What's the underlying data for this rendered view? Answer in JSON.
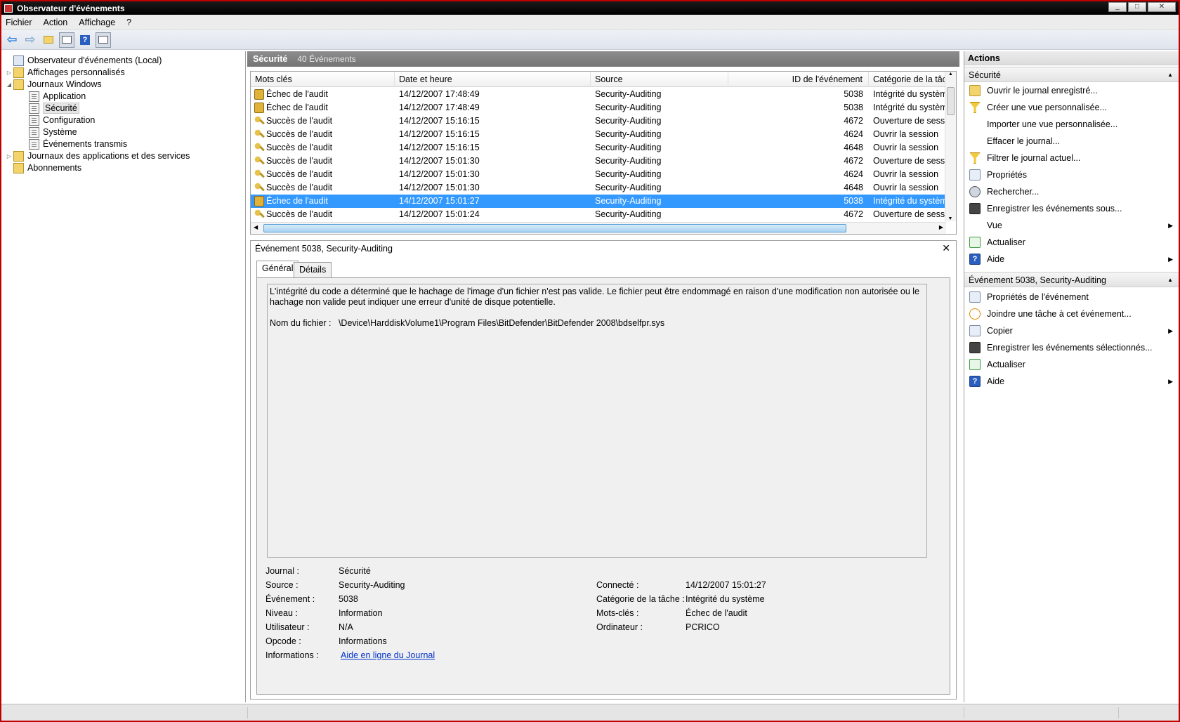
{
  "window": {
    "title": "Observateur d'événements"
  },
  "menu": [
    "Fichier",
    "Action",
    "Affichage",
    "?"
  ],
  "tree": [
    {
      "label": "Observateur d'événements (Local)",
      "icon": "event-viewer-icon"
    },
    {
      "label": "Affichages personnalisés",
      "icon": "folder-icon"
    },
    {
      "label": "Journaux Windows",
      "icon": "folder-icon"
    },
    {
      "label": "Application",
      "icon": "log-icon"
    },
    {
      "label": "Sécurité",
      "icon": "log-icon",
      "selected": true
    },
    {
      "label": "Configuration",
      "icon": "log-icon"
    },
    {
      "label": "Système",
      "icon": "log-icon"
    },
    {
      "label": "Événements transmis",
      "icon": "log-icon"
    },
    {
      "label": "Journaux des applications et des services",
      "icon": "folder-icon"
    },
    {
      "label": "Abonnements",
      "icon": "subscription-icon"
    }
  ],
  "log": {
    "name": "Sécurité",
    "count": "40 Événements"
  },
  "columns": [
    "Mots clés",
    "Date et heure",
    "Source",
    "ID de l'événement",
    "Catégorie de la tâche"
  ],
  "events": [
    {
      "kw": "Échec de l'audit",
      "date": "14/12/2007 17:48:49",
      "src": "Security-Auditing",
      "id": "5038",
      "cat": "Intégrité du système",
      "icon": "lock"
    },
    {
      "kw": "Échec de l'audit",
      "date": "14/12/2007 17:48:49",
      "src": "Security-Auditing",
      "id": "5038",
      "cat": "Intégrité du système",
      "icon": "lock"
    },
    {
      "kw": "Succès de l'audit",
      "date": "14/12/2007 15:16:15",
      "src": "Security-Auditing",
      "id": "4672",
      "cat": "Ouverture de session spéciale",
      "icon": "key"
    },
    {
      "kw": "Succès de l'audit",
      "date": "14/12/2007 15:16:15",
      "src": "Security-Auditing",
      "id": "4624",
      "cat": "Ouvrir la session",
      "icon": "key"
    },
    {
      "kw": "Succès de l'audit",
      "date": "14/12/2007 15:16:15",
      "src": "Security-Auditing",
      "id": "4648",
      "cat": "Ouvrir la session",
      "icon": "key"
    },
    {
      "kw": "Succès de l'audit",
      "date": "14/12/2007 15:01:30",
      "src": "Security-Auditing",
      "id": "4672",
      "cat": "Ouverture de session spéciale",
      "icon": "key"
    },
    {
      "kw": "Succès de l'audit",
      "date": "14/12/2007 15:01:30",
      "src": "Security-Auditing",
      "id": "4624",
      "cat": "Ouvrir la session",
      "icon": "key"
    },
    {
      "kw": "Succès de l'audit",
      "date": "14/12/2007 15:01:30",
      "src": "Security-Auditing",
      "id": "4648",
      "cat": "Ouvrir la session",
      "icon": "key"
    },
    {
      "kw": "Échec de l'audit",
      "date": "14/12/2007 15:01:27",
      "src": "Security-Auditing",
      "id": "5038",
      "cat": "Intégrité du système",
      "icon": "lock",
      "selected": true
    },
    {
      "kw": "Succès de l'audit",
      "date": "14/12/2007 15:01:24",
      "src": "Security-Auditing",
      "id": "4672",
      "cat": "Ouverture de session spéciale",
      "icon": "key"
    }
  ],
  "detail": {
    "title": "Événement 5038, Security-Auditing",
    "tabs": [
      "Général",
      "Détails"
    ],
    "description": "L'intégrité du code a déterminé que le hachage de l'image d'un fichier n'est pas valide. Le fichier peut être endommagé en raison d'une modification non autorisée ou le hachage non valide peut indiquer une erreur d'unité de disque potentielle.",
    "filename_label": "Nom du fichier :",
    "filename": "\\Device\\HarddiskVolume1\\Program Files\\BitDefender\\BitDefender 2008\\bdselfpr.sys",
    "left": [
      {
        "label": "Journal :",
        "value": "Sécurité"
      },
      {
        "label": "Source :",
        "value": "Security-Auditing"
      },
      {
        "label": "Événement :",
        "value": "5038"
      },
      {
        "label": "Niveau :",
        "value": "Information"
      },
      {
        "label": "Utilisateur :",
        "value": "N/A"
      },
      {
        "label": "Opcode :",
        "value": "Informations"
      },
      {
        "label": "Informations :",
        "value": "Aide en ligne du Journal"
      }
    ],
    "right": [
      {
        "label": "Connecté :",
        "value": "14/12/2007 15:01:27"
      },
      {
        "label": "Catégorie de la tâche :",
        "value": "Intégrité du système"
      },
      {
        "label": "Mots-clés :",
        "value": "Échec de l'audit"
      },
      {
        "label": "Ordinateur :",
        "value": "PCRICO"
      }
    ]
  },
  "actions": {
    "header": "Actions",
    "group1": "Sécurité",
    "items1": [
      {
        "label": "Ouvrir le journal enregistré...",
        "icon": "folder-open-icon"
      },
      {
        "label": "Créer une vue personnalisée...",
        "icon": "filter-icon"
      },
      {
        "label": "Importer une vue personnalisée...",
        "icon": ""
      },
      {
        "label": "Effacer le journal...",
        "icon": ""
      },
      {
        "label": "Filtrer le journal actuel...",
        "icon": "filter-icon"
      },
      {
        "label": "Propriétés",
        "icon": "properties-icon"
      },
      {
        "label": "Rechercher...",
        "icon": "find-icon"
      },
      {
        "label": "Enregistrer les événements sous...",
        "icon": "save-icon"
      },
      {
        "label": "Vue",
        "icon": "",
        "submenu": true
      },
      {
        "label": "Actualiser",
        "icon": "refresh-icon"
      },
      {
        "label": "Aide",
        "icon": "help-icon",
        "submenu": true
      }
    ],
    "group2": "Événement 5038, Security-Auditing",
    "items2": [
      {
        "label": "Propriétés de l'événement",
        "icon": "properties-icon"
      },
      {
        "label": "Joindre une tâche à cet événement...",
        "icon": "task-icon"
      },
      {
        "label": "Copier",
        "icon": "copy-icon",
        "submenu": true
      },
      {
        "label": "Enregistrer les événements sélectionnés...",
        "icon": "save-icon"
      },
      {
        "label": "Actualiser",
        "icon": "refresh-icon"
      },
      {
        "label": "Aide",
        "icon": "help-icon",
        "submenu": true
      }
    ]
  }
}
